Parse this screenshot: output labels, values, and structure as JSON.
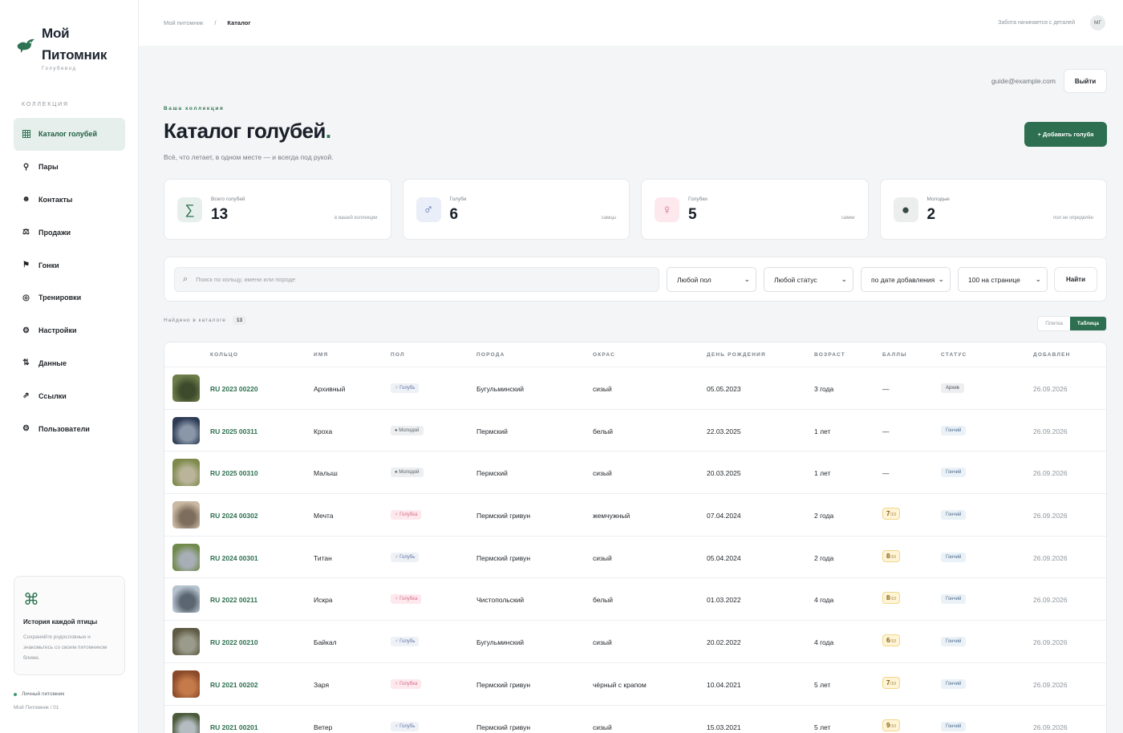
{
  "brand": {
    "title_line1": "Мой",
    "title_line2": "Питомник",
    "subtitle": "Голубевод"
  },
  "sidebar": {
    "section": "КОЛЛЕКЦИЯ",
    "items": [
      {
        "label": "Каталог голубей",
        "icon": "grid-icon"
      },
      {
        "label": "Пары",
        "icon": "pin-icon"
      },
      {
        "label": "Контакты",
        "icon": "smile-icon"
      },
      {
        "label": "Продажи",
        "icon": "scale-icon"
      },
      {
        "label": "Гонки",
        "icon": "flag-icon"
      },
      {
        "label": "Тренировки",
        "icon": "target-icon"
      },
      {
        "label": "Настройки",
        "icon": "gear-icon"
      },
      {
        "label": "Данные",
        "icon": "sort-icon"
      },
      {
        "label": "Ссылки",
        "icon": "link-icon"
      },
      {
        "label": "Пользователи",
        "icon": "users-icon"
      }
    ],
    "promo": {
      "icon": "command-icon",
      "title": "История каждой птицы",
      "text": "Сохраняйте родословные и знакомьтесь со своим питомником ближе."
    },
    "status": "Личный питомник",
    "footer": "Мой Питомник / 01"
  },
  "topbar": {
    "breadcrumbs": [
      "Мой питомник",
      "/",
      "Каталог"
    ],
    "tagline": "Забота начинается с деталей",
    "avatar": "МГ"
  },
  "user": {
    "email": "guide@example.com",
    "logout": "Выйти"
  },
  "page": {
    "eyebrow": "Ваша коллекция",
    "title": "Каталог голубей",
    "title_dot": ".",
    "subtitle": "Всё, что летает, в одном месте — и всегда под рукой.",
    "add_button": "+ Добавить голубя"
  },
  "stats": [
    {
      "label": "Всего голубей",
      "value": "13",
      "note": "в вашей коллекции",
      "icon": "sigma-icon",
      "color": "#2d7353",
      "bg": "#e6efeb",
      "glyph": "∑"
    },
    {
      "label": "Голуби",
      "value": "6",
      "note": "самцы",
      "icon": "male-icon",
      "color": "#5b73b0",
      "bg": "#e9eef8",
      "glyph": "♂"
    },
    {
      "label": "Голубки",
      "value": "5",
      "note": "самки",
      "icon": "female-icon",
      "color": "#d56a86",
      "bg": "#fde8ee",
      "glyph": "♀"
    },
    {
      "label": "Молодые",
      "value": "2",
      "note": "пол не определён",
      "icon": "dot-icon",
      "color": "#3a4a46",
      "bg": "#eceeee",
      "glyph": "●"
    }
  ],
  "filters": {
    "search_placeholder": "Поиск по кольцу, имени или породе",
    "sex": "Любой пол",
    "status": "Любой статус",
    "sort": "по дате добавления",
    "per_page": "100 на странице",
    "find": "Найти"
  },
  "results": {
    "label": "Найдено в каталоге",
    "count": "13"
  },
  "view": {
    "tile": "Плитка",
    "table": "Таблица"
  },
  "table": {
    "headers": [
      "КОЛЬЦО",
      "ИМЯ",
      "ПОЛ",
      "ПОРОДА",
      "ОКРАС",
      "ДЕНЬ РОЖДЕНИЯ",
      "ВОЗРАСТ",
      "БАЛЛЫ",
      "СТАТУС",
      "ДОБАВЛЕН"
    ],
    "rows": [
      {
        "ring": "RU 2023 00220",
        "name": "Архивный",
        "sex": "♂ Голубь",
        "sex_type": "male",
        "breed": "Бугульминский",
        "color": "сизый",
        "birthday": "05.05.2023",
        "age": "3 года",
        "score": "",
        "score_max": "",
        "status": "Архив",
        "status_type": "archive",
        "added": "26.09.2026",
        "thumb": [
          "#6d7d4a",
          "#3e4a2c"
        ]
      },
      {
        "ring": "RU 2025 00311",
        "name": "Кроха",
        "sex": "● Молодой",
        "sex_type": "young",
        "breed": "Пермский",
        "color": "белый",
        "birthday": "22.03.2025",
        "age": "1 лет",
        "score": "",
        "score_max": "",
        "status": "Гончий",
        "status_type": "racer",
        "added": "26.09.2026",
        "thumb": [
          "#2d3b55",
          "#8a97a8"
        ]
      },
      {
        "ring": "RU 2025 00310",
        "name": "Малыш",
        "sex": "● Молодой",
        "sex_type": "young",
        "breed": "Пермский",
        "color": "сизый",
        "birthday": "20.03.2025",
        "age": "1 лет",
        "score": "",
        "score_max": "",
        "status": "Гончий",
        "status_type": "racer",
        "added": "26.09.2026",
        "thumb": [
          "#7e8a4c",
          "#b9b49a"
        ]
      },
      {
        "ring": "RU 2024 00302",
        "name": "Мечта",
        "sex": "♀ Голубка",
        "sex_type": "female",
        "breed": "Пермский гривун",
        "color": "жемчужный",
        "birthday": "07.04.2024",
        "age": "2 года",
        "score": "7",
        "score_max": "/10",
        "status": "Гончий",
        "status_type": "racer",
        "added": "26.09.2026",
        "thumb": [
          "#c9b9a3",
          "#7d6d5c"
        ]
      },
      {
        "ring": "RU 2024 00301",
        "name": "Титан",
        "sex": "♂ Голубь",
        "sex_type": "male",
        "breed": "Пермский гривун",
        "color": "сизый",
        "birthday": "05.04.2024",
        "age": "2 года",
        "score": "8",
        "score_max": "/10",
        "status": "Гончий",
        "status_type": "racer",
        "added": "26.09.2026",
        "thumb": [
          "#6f8a4a",
          "#a7aeb6"
        ]
      },
      {
        "ring": "RU 2022 00211",
        "name": "Искра",
        "sex": "♀ Голубка",
        "sex_type": "female",
        "breed": "Чистопольский",
        "color": "белый",
        "birthday": "01.03.2022",
        "age": "4 года",
        "score": "8",
        "score_max": "/10",
        "status": "Гончий",
        "status_type": "racer",
        "added": "26.09.2026",
        "thumb": [
          "#b5c3cf",
          "#5b6670"
        ]
      },
      {
        "ring": "RU 2022 00210",
        "name": "Байкал",
        "sex": "♂ Голубь",
        "sex_type": "male",
        "breed": "Бугульминский",
        "color": "сизый",
        "birthday": "20.02.2022",
        "age": "4 года",
        "score": "6",
        "score_max": "/10",
        "status": "Гончий",
        "status_type": "racer",
        "added": "26.09.2026",
        "thumb": [
          "#5f5a44",
          "#9a9b8b"
        ]
      },
      {
        "ring": "RU 2021 00202",
        "name": "Заря",
        "sex": "♀ Голубка",
        "sex_type": "female",
        "breed": "Пермский гривун",
        "color": "чёрный с крапом",
        "birthday": "10.04.2021",
        "age": "5 лет",
        "score": "7",
        "score_max": "/10",
        "status": "Гончий",
        "status_type": "racer",
        "added": "26.09.2026",
        "thumb": [
          "#8a4a2a",
          "#c47a4a"
        ]
      },
      {
        "ring": "RU 2021 00201",
        "name": "Ветер",
        "sex": "♂ Голубь",
        "sex_type": "male",
        "breed": "Пермский гривун",
        "color": "сизый",
        "birthday": "15.03.2021",
        "age": "5 лет",
        "score": "9",
        "score_max": "/10",
        "status": "Гончий",
        "status_type": "racer",
        "added": "26.09.2026",
        "thumb": [
          "#4a5a3a",
          "#b4bcc2"
        ]
      }
    ],
    "empty_score": "—"
  }
}
